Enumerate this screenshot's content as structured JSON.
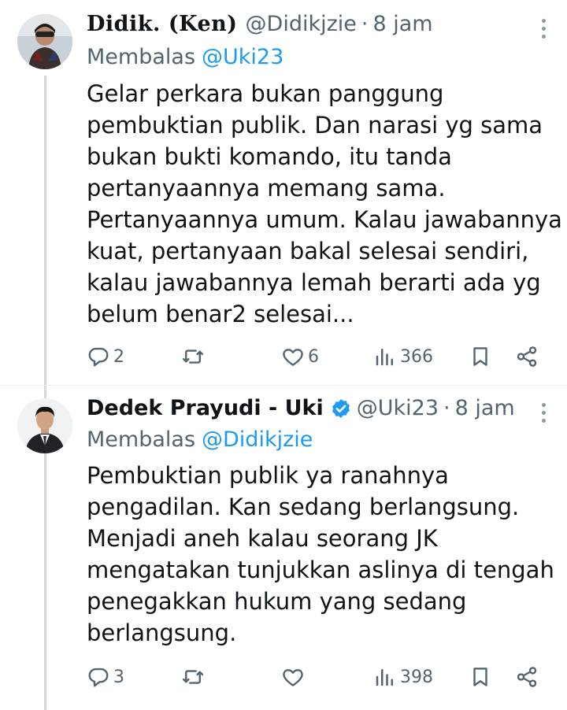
{
  "tweets": [
    {
      "display_name": "Didik. (Ken)",
      "handle": "@Didikjzie",
      "separator": "·",
      "time": "8 jam",
      "reply_prefix": "Membalas",
      "reply_to": "@Uki23",
      "body_lines": [
        "Gelar perkara bukan panggung",
        "pembuktian publik. Dan narasi yg sama",
        "bukan bukti komando, itu tanda",
        "pertanyaannya memang sama.",
        "Pertanyaannya umum. Kalau jawabannya",
        "kuat, pertanyaan bakal selesai sendiri,",
        "kalau jawabannya lemah berarti ada yg",
        "belum benar2 selesai..."
      ],
      "verified": false,
      "replies": "2",
      "reposts": "",
      "likes": "6",
      "views": "366"
    },
    {
      "display_name": "Dedek Prayudi - Uki",
      "handle": "@Uki23",
      "separator": "·",
      "time": "8 jam",
      "reply_prefix": "Membalas",
      "reply_to": "@Didikjzie",
      "body_lines": [
        "Pembuktian publik ya ranahnya",
        "pengadilan. Kan sedang berlangsung.",
        "Menjadi aneh kalau seorang JK",
        "mengatakan tunjukkan aslinya di tengah",
        "penegakkan hukum yang sedang",
        "berlangsung."
      ],
      "verified": true,
      "replies": "3",
      "reposts": "",
      "likes": "",
      "views": "398"
    }
  ],
  "icons": {
    "reply": "reply-icon",
    "repost": "repost-icon",
    "like": "heart-icon",
    "views": "views-icon",
    "bookmark": "bookmark-icon",
    "share": "share-icon",
    "more": "more-icon",
    "verified": "verified-badge-icon"
  },
  "colors": {
    "text": "#0f1419",
    "secondary": "#536471",
    "link": "#1d9bf0",
    "thread_line": "#cfd9de"
  }
}
